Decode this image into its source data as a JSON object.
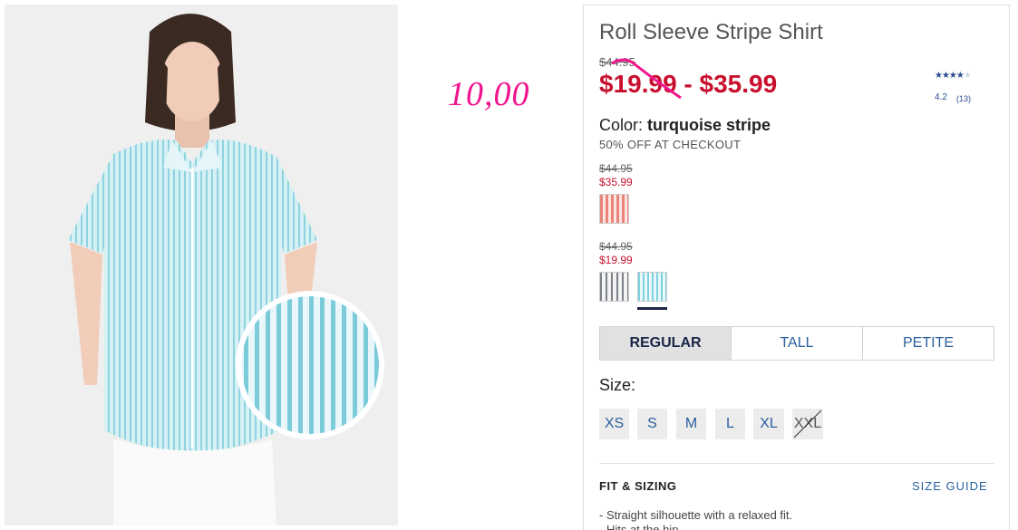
{
  "annotation": "10,00",
  "product": {
    "title": "Roll Sleeve Stripe Shirt",
    "original_price": "$44.95",
    "sale_price_low": "$19.99",
    "sale_price_sep": " - ",
    "sale_price_high": "$35.99"
  },
  "rating": {
    "stars": "★★★★",
    "empty_star": "★",
    "value": "4.2",
    "count": "(13)"
  },
  "color": {
    "label": "Color:",
    "value": "turquoise stripe",
    "promo": "50% OFF AT CHECKOUT"
  },
  "swatch_groups": [
    {
      "old_price": "$44.95",
      "new_price": "$35.99",
      "swatches": [
        "pink stripe"
      ]
    },
    {
      "old_price": "$44.95",
      "new_price": "$19.99",
      "swatches": [
        "grey stripe",
        "turquoise stripe"
      ],
      "selected": "turquoise stripe"
    }
  ],
  "fit_tabs": [
    {
      "label": "REGULAR",
      "active": true
    },
    {
      "label": "TALL",
      "active": false
    },
    {
      "label": "PETITE",
      "active": false
    }
  ],
  "size": {
    "label": "Size:",
    "options": [
      {
        "label": "XS",
        "available": true
      },
      {
        "label": "S",
        "available": true
      },
      {
        "label": "M",
        "available": true
      },
      {
        "label": "L",
        "available": true
      },
      {
        "label": "XL",
        "available": true
      },
      {
        "label": "XXL",
        "available": false
      }
    ]
  },
  "fit_sizing": {
    "heading": "FIT & SIZING",
    "guide_link": "SIZE GUIDE",
    "bullets": [
      "- Straight silhouette with a relaxed fit.",
      "- Hits at the hip."
    ]
  },
  "colors": {
    "sale_red": "#c8102e",
    "link_blue": "#2a5f9e",
    "annotation_pink": "#f0138c",
    "shirt": "#bfe6ee"
  },
  "icons": [
    "star-icon",
    "strike-through-mark",
    "fabric-zoom-circle"
  ]
}
